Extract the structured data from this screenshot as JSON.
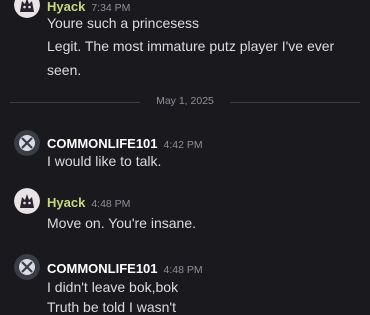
{
  "messages": [
    {
      "author": "Hyack",
      "author_color": "#c5d97e",
      "time": "7:34 PM",
      "avatar_icon": "hyack-avatar-icon",
      "lines": [
        "Youre such a princesess",
        "Legit. The most immature putz player I've ever",
        "seen."
      ]
    },
    {
      "author": "COMMONLIFE101",
      "author_color": "#ffffff",
      "time": "4:42 PM",
      "avatar_icon": "xbox-avatar-icon",
      "lines": [
        "I would like to talk."
      ]
    },
    {
      "author": "Hyack",
      "author_color": "#c5d97e",
      "time": "4:48 PM",
      "avatar_icon": "hyack-avatar-icon",
      "lines": [
        "Move on. You're insane."
      ]
    },
    {
      "author": "COMMONLIFE101",
      "author_color": "#ffffff",
      "time": "4:48 PM",
      "avatar_icon": "xbox-avatar-icon",
      "lines": [
        "I didn't leave bok,bok",
        "Truth be told I wasn't"
      ]
    }
  ],
  "divider": {
    "date": "May 1, 2025"
  }
}
